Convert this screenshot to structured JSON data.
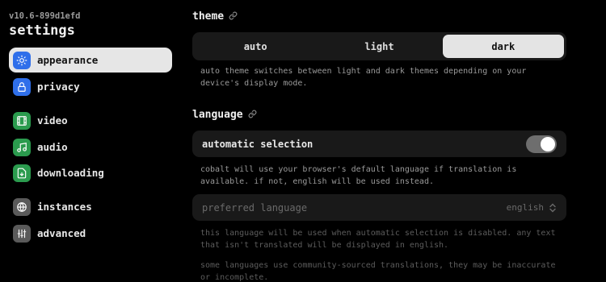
{
  "version": "v10.6-899d1efd",
  "page_title": "settings",
  "sidebar": {
    "items": [
      {
        "label": "appearance",
        "icon": "sun-icon",
        "color": "#2f6fea"
      },
      {
        "label": "privacy",
        "icon": "lock-icon",
        "color": "#2f6fea"
      },
      {
        "label": "video",
        "icon": "film-icon",
        "color": "#2b9b4e"
      },
      {
        "label": "audio",
        "icon": "music-icon",
        "color": "#2b9b4e"
      },
      {
        "label": "downloading",
        "icon": "download-file-icon",
        "color": "#2b9b4e"
      },
      {
        "label": "instances",
        "icon": "globe-icon",
        "color": "#5a5a5a"
      },
      {
        "label": "advanced",
        "icon": "sliders-icon",
        "color": "#5a5a5a"
      }
    ],
    "active": "appearance"
  },
  "theme": {
    "title": "theme",
    "options": [
      "auto",
      "light",
      "dark"
    ],
    "selected": "dark",
    "description": "auto theme switches between light and dark themes depending on your device's display mode."
  },
  "language": {
    "title": "language",
    "automatic_label": "automatic selection",
    "automatic_enabled": true,
    "automatic_description": "cobalt will use your browser's default language if translation is available. if not, english will be used instead.",
    "preferred_label": "preferred language",
    "preferred_value": "english",
    "preferred_description": "this language will be used when automatic selection is disabled. any text that isn't translated will be displayed in english.",
    "community_note": "some languages use community-sourced translations, they may be inaccurate or incomplete."
  }
}
